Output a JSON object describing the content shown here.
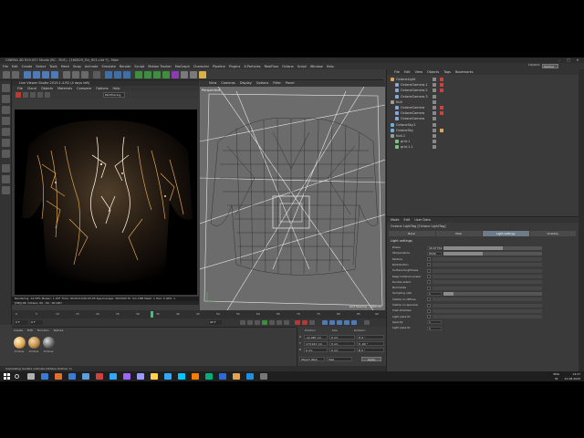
{
  "window": {
    "title": "CINEMA 4D R19.057 Studio (RC - R19) - [160829_Tut_H01.c4d *] - Main",
    "controls": [
      "–",
      "□",
      "✕"
    ]
  },
  "menubar": {
    "items": [
      "File",
      "Edit",
      "Create",
      "Select",
      "Tools",
      "Mesh",
      "Snap",
      "Animate",
      "Simulate",
      "Render",
      "Sculpt",
      "Motion Tracker",
      "MoGraph",
      "Character",
      "Pipeline",
      "Plugins",
      "X-Particles",
      "RealFlow",
      "Octane",
      "Script",
      "Window",
      "Help"
    ],
    "layout_label": "Layout:",
    "layout_value": "Startup"
  },
  "live_viewer": {
    "title": "Live Viewer Studio 2019.1.4-R2 (4 days left)",
    "menu": [
      "File",
      "Cloud",
      "Objects",
      "Materials",
      "Compare",
      "Options",
      "Help"
    ],
    "mode_value": "PathTracing",
    "status": "Rendering: 14.39%   Ms/sec: 1.207   Time: 00:00:01/00:00:05   Spp/maxspp: 36/2000   Tri: 0/1.18M   Mesh: 1   Hair: 0   GPU: 1",
    "status2": "[OBJ] 06: Octane: 00 : 00 : 00   GPU"
  },
  "viewport": {
    "menu": [
      "View",
      "Cameras",
      "Display",
      "Options",
      "Filter",
      "Panel"
    ],
    "label": "Perspective",
    "grid": "Grid Spacing : 1000 cm"
  },
  "timeline": {
    "ticks": [
      "0",
      "5",
      "10",
      "15",
      "20",
      "25",
      "30",
      "35",
      "40",
      "45",
      "50",
      "55",
      "60",
      "65",
      "70",
      "75",
      "80",
      "85",
      "90"
    ],
    "current_frame": "0 F",
    "start": "0 F",
    "end": "90 F"
  },
  "materials": {
    "menu": [
      "Create",
      "Edit",
      "Function",
      "Texture"
    ],
    "items": [
      {
        "name": "Octane",
        "color": "#e0a552"
      },
      {
        "name": "Octane",
        "color": "#c08a4a"
      },
      {
        "name": "Octane",
        "color": "#666666"
      }
    ]
  },
  "coordinates": {
    "headers": [
      "Position",
      "Size",
      "Rotation"
    ],
    "rows": [
      {
        "axis": "X",
        "pos": "-11.987 cm",
        "size": "0 cm",
        "rot": "H  0 °"
      },
      {
        "axis": "Y",
        "pos": "173.917 cm",
        "size": "0 cm",
        "rot": "P  -90 °"
      },
      {
        "axis": "Z",
        "pos": "0 cm",
        "size": "0 cm",
        "rot": "B  0 °"
      }
    ],
    "mode": "Object (Rel)",
    "size_mode": "Size",
    "apply": "Apply"
  },
  "object_manager": {
    "menu": [
      "File",
      "Edit",
      "View",
      "Objects",
      "Tags",
      "Bookmarks"
    ],
    "objects": [
      {
        "name": "OctaneLight",
        "indent": 0,
        "color": "#e0a552",
        "tag": "#d04040"
      },
      {
        "name": "OctaneCamera.1",
        "indent": 1,
        "color": "#8aa6d6",
        "tag": "#d04040"
      },
      {
        "name": "OctaneCamera.2",
        "indent": 1,
        "color": "#8aa6d6",
        "tag": "#d04040"
      },
      {
        "name": "OctaneCamera.3",
        "indent": 1,
        "color": "#8aa6d6",
        "tag": ""
      },
      {
        "name": "Null",
        "indent": 0,
        "color": "#9b9b9b",
        "tag": ""
      },
      {
        "name": "OctaneCamera",
        "indent": 1,
        "color": "#8aa6d6",
        "tag": "#d04040"
      },
      {
        "name": "OctaneCamera",
        "indent": 1,
        "color": "#8aa6d6",
        "tag": "#d04040"
      },
      {
        "name": "OctaneCamera",
        "indent": 1,
        "color": "#8aa6d6",
        "tag": ""
      },
      {
        "name": "OctaneSky.1",
        "indent": 0,
        "color": "#6fb0d8",
        "tag": ""
      },
      {
        "name": "OctaneSky",
        "indent": 0,
        "color": "#6fb0d8",
        "tag": "#e0a552"
      },
      {
        "name": "Null.1",
        "indent": 0,
        "color": "#9b9b9b",
        "tag": ""
      },
      {
        "name": "grid.1",
        "indent": 1,
        "color": "#7fc27f",
        "tag": ""
      },
      {
        "name": "grid.1.1",
        "indent": 1,
        "color": "#7fc27f",
        "tag": ""
      }
    ]
  },
  "attributes": {
    "menu": [
      "Mode",
      "Edit",
      "User Data"
    ],
    "header": "Octane LightTag [Octane LightTag]",
    "tabs": [
      "Basic",
      "Main",
      "Light settings",
      "Visibility"
    ],
    "active_tab": "Light settings",
    "section": "Light settings",
    "rows": [
      {
        "label": "Power",
        "value": "40.67761",
        "slider": 0.6
      },
      {
        "label": "Temperature",
        "value": "6500",
        "slider": 0.4
      },
      {
        "label": "Texture",
        "value": "",
        "slider": -1
      },
      {
        "label": "Distribution",
        "value": "",
        "slider": -1
      },
      {
        "label": "Surface brightness",
        "value": "",
        "slider": -1
      },
      {
        "label": "Keep instance power",
        "value": "",
        "slider": -1
      },
      {
        "label": "Double sided",
        "value": "",
        "slider": -1
      },
      {
        "label": "Normalize",
        "value": "",
        "slider": -1
      },
      {
        "label": "Sampling rate",
        "value": "1",
        "slider": 0.1
      },
      {
        "label": "Visible on diffuse",
        "value": "",
        "slider": -1
      },
      {
        "label": "Visible on specular",
        "value": "",
        "slider": -1
      },
      {
        "label": "Cast shadows",
        "value": "",
        "slider": -1
      },
      {
        "label": "Light pass ID",
        "value": "",
        "slider": -1
      },
      {
        "label": "Opacity",
        "value": "1",
        "slider": -1
      },
      {
        "label": "Light pass ID",
        "value": "1",
        "slider": -1
      }
    ]
  },
  "status_line": "Calculating renders outnoise (Octane Outline: 1)",
  "taskbar": {
    "apps": [
      {
        "color": "#b0b0b0"
      },
      {
        "color": "#3a7bd5"
      },
      {
        "color": "#e07030"
      },
      {
        "color": "#3a7bd5"
      },
      {
        "color": "#5aa0e0"
      },
      {
        "color": "#d04040"
      },
      {
        "color": "#31a8ff"
      },
      {
        "color": "#9a66ff"
      },
      {
        "color": "#9999ff"
      },
      {
        "color": "#ffd24d"
      },
      {
        "color": "#31a8ff"
      },
      {
        "color": "#00c8ff"
      },
      {
        "color": "#ff7c00"
      },
      {
        "color": "#00b07a"
      },
      {
        "color": "#2d6ad6"
      },
      {
        "color": "#e0a552"
      },
      {
        "color": "#1f8fe0"
      },
      {
        "color": "#777777"
      }
    ],
    "lang": "ENG",
    "lang2": "IN",
    "time": "14:27",
    "date": "21-08-2020"
  },
  "colors": {
    "accent": "#6e7c8a",
    "glow": "#f2a94a"
  }
}
